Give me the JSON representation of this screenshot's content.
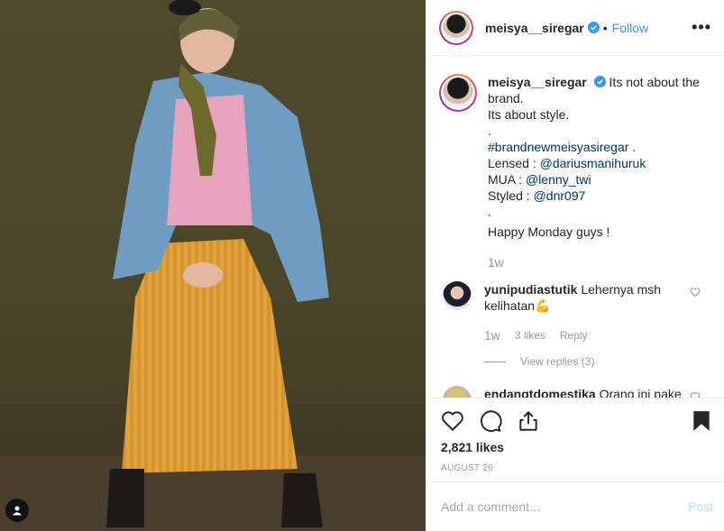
{
  "post": {
    "username": "meisya__siregar",
    "verified": true,
    "separator": "•",
    "follow_label": "Follow",
    "more_label": "•••"
  },
  "caption": {
    "username": "meisya__siregar",
    "line1": "Its not about the brand.",
    "line2": "Its about style.",
    "line3": ".",
    "hashtag": "#brandnewmeisyasiregar",
    "hashtag_after": " .",
    "lensed_label": "Lensed : ",
    "lensed_link": "@dariusmanihuruk",
    "mua_label": "MUA : ",
    "mua_link": "@lenny_twi",
    "styled_label": "Styled : ",
    "styled_link": "@dnr097",
    "line4": ".",
    "line5": "Happy Monday guys !",
    "time": "1w"
  },
  "comments": [
    {
      "username": "yunipudiastutik",
      "text": "Lehernya msh kelihatan💪",
      "time": "1w",
      "likes": "3 likes",
      "reply_label": "Reply",
      "view_replies": "View replies (3)"
    },
    {
      "username": "endangtdomestika",
      "text": "Orang ini pake"
    }
  ],
  "footer": {
    "likes": "2,821 likes",
    "date": "AUGUST 26",
    "add_comment_placeholder": "Add a comment...",
    "post_label": "Post"
  },
  "colors": {
    "link": "#003569",
    "follow": "#3897f0",
    "muted": "#999999",
    "post_disabled": "#b2dffc"
  }
}
